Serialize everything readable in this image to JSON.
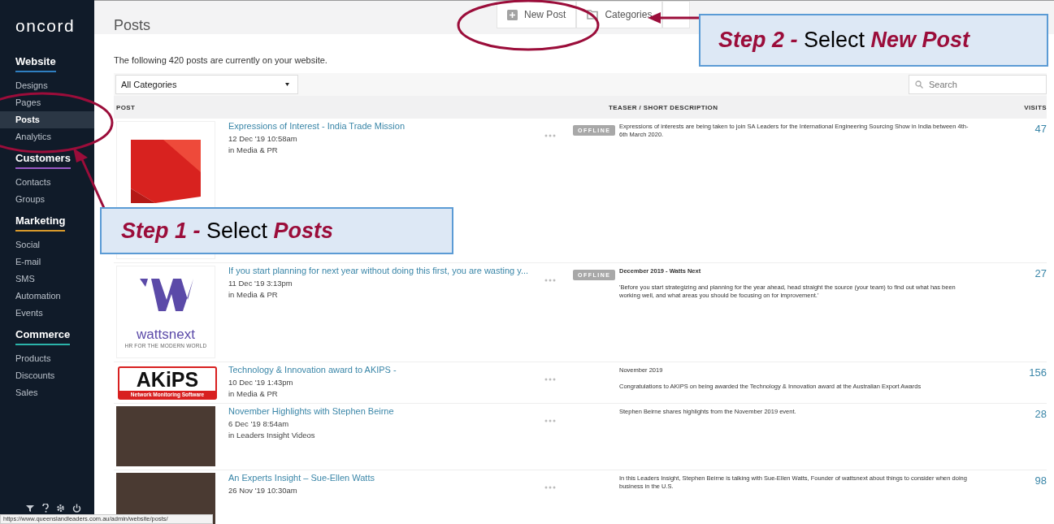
{
  "sidebar": {
    "logo": "oncord",
    "sections": [
      {
        "title": "Website",
        "color": "#2f7fc0",
        "items": [
          {
            "label": "Designs",
            "selected": false
          },
          {
            "label": "Pages",
            "selected": false
          },
          {
            "label": "Posts",
            "selected": true
          },
          {
            "label": "Analytics",
            "selected": false
          }
        ]
      },
      {
        "title": "Customers",
        "color": "#9b59c6",
        "items": [
          {
            "label": "Contacts",
            "selected": false
          },
          {
            "label": "Groups",
            "selected": false
          }
        ]
      },
      {
        "title": "Marketing",
        "color": "#d9992b",
        "items": [
          {
            "label": "Social",
            "selected": false
          },
          {
            "label": "E-mail",
            "selected": false
          },
          {
            "label": "SMS",
            "selected": false
          },
          {
            "label": "Automation",
            "selected": false
          },
          {
            "label": "Events",
            "selected": false
          }
        ]
      },
      {
        "title": "Commerce",
        "color": "#2bb3a9",
        "items": [
          {
            "label": "Products",
            "selected": false
          },
          {
            "label": "Discounts",
            "selected": false
          },
          {
            "label": "Sales",
            "selected": false
          }
        ]
      }
    ]
  },
  "header": {
    "title": "Posts",
    "actions": [
      {
        "label": "New Post",
        "kind": "plus"
      },
      {
        "label": "Categories",
        "kind": "folder"
      }
    ]
  },
  "summary": "The following 420 posts are currently on your website.",
  "filter": {
    "value": "All Categories"
  },
  "search": {
    "placeholder": "Search"
  },
  "table": {
    "columns": [
      "POST",
      "TEASER / SHORT DESCRIPTION",
      "VISITS"
    ],
    "rows": [
      {
        "thumbnail": {
          "kind": "red-graphic"
        },
        "title": "Expressions of Interest - India Trade Mission",
        "date": "12 Dec '19 10:58am",
        "category": "in Media & PR",
        "status": "OFFLINE",
        "teaser": [
          {
            "kind": "plain",
            "text": "Expressions of interests are being taken to join SA Leaders for the International Engineering Sourcing Show in India between 4th-6th March 2020."
          }
        ],
        "visits": "47"
      },
      {
        "thumbnail": {
          "kind": "w-logo",
          "name": "wattsnext",
          "tagline": "HR FOR THE MODERN WORLD"
        },
        "title": "If you start planning for next year without doing this first, you are wasting y...",
        "date": "11 Dec '19 3:13pm",
        "category": "in Media & PR",
        "status": "OFFLINE",
        "teaser": [
          {
            "kind": "bold",
            "text": "December 2019 - Watts Next"
          },
          {
            "kind": "plain",
            "text": "'Before you start strategizing and planning for the year ahead, head straight the source (your team) to find out what has been working well, and what areas you should be focusing on for improvement.'"
          }
        ],
        "visits": "27"
      },
      {
        "thumbnail": {
          "kind": "boxed-logo",
          "name": "AKiPS",
          "tagline": "Network Monitoring Software"
        },
        "title": "Technology & Innovation award to AKIPS -",
        "date": "10 Dec '19 1:43pm",
        "category": "in Media & PR",
        "teaser": [
          {
            "kind": "plain",
            "text": "November 2019"
          },
          {
            "kind": "plain",
            "text": "Congratulations to AKIPS on being awarded the Technology & Innovation award at the Australian Export Awards"
          }
        ],
        "visits": "156"
      },
      {
        "thumbnail": {
          "kind": "video"
        },
        "title": "November Highlights with Stephen Beirne",
        "date": "6 Dec '19 8:54am",
        "category": "in Leaders Insight Videos",
        "teaser": [
          {
            "kind": "plain",
            "text": "Stephen Beirne shares highlights from the November 2019 event."
          }
        ],
        "visits": "28"
      },
      {
        "thumbnail": {
          "kind": "video"
        },
        "title": "An Experts Insight – Sue-Ellen Watts",
        "date": "26 Nov '19 10:30am",
        "teaser": [
          {
            "kind": "plain",
            "text": "In this Leaders Insight, Stephen Beirne is talking with Sue-Ellen Watts, Founder of wattsnext about things to consider when doing business in the U.S."
          }
        ],
        "visits": "98"
      }
    ]
  },
  "status_bar": "https://www.queenslandleaders.com.au/admin/website/posts/",
  "callouts": [
    {
      "kind": "step1",
      "text": "*Step 1 -* Select *Posts*"
    },
    {
      "kind": "step2",
      "text": "*Step 2 -* Select *New Post*"
    }
  ]
}
